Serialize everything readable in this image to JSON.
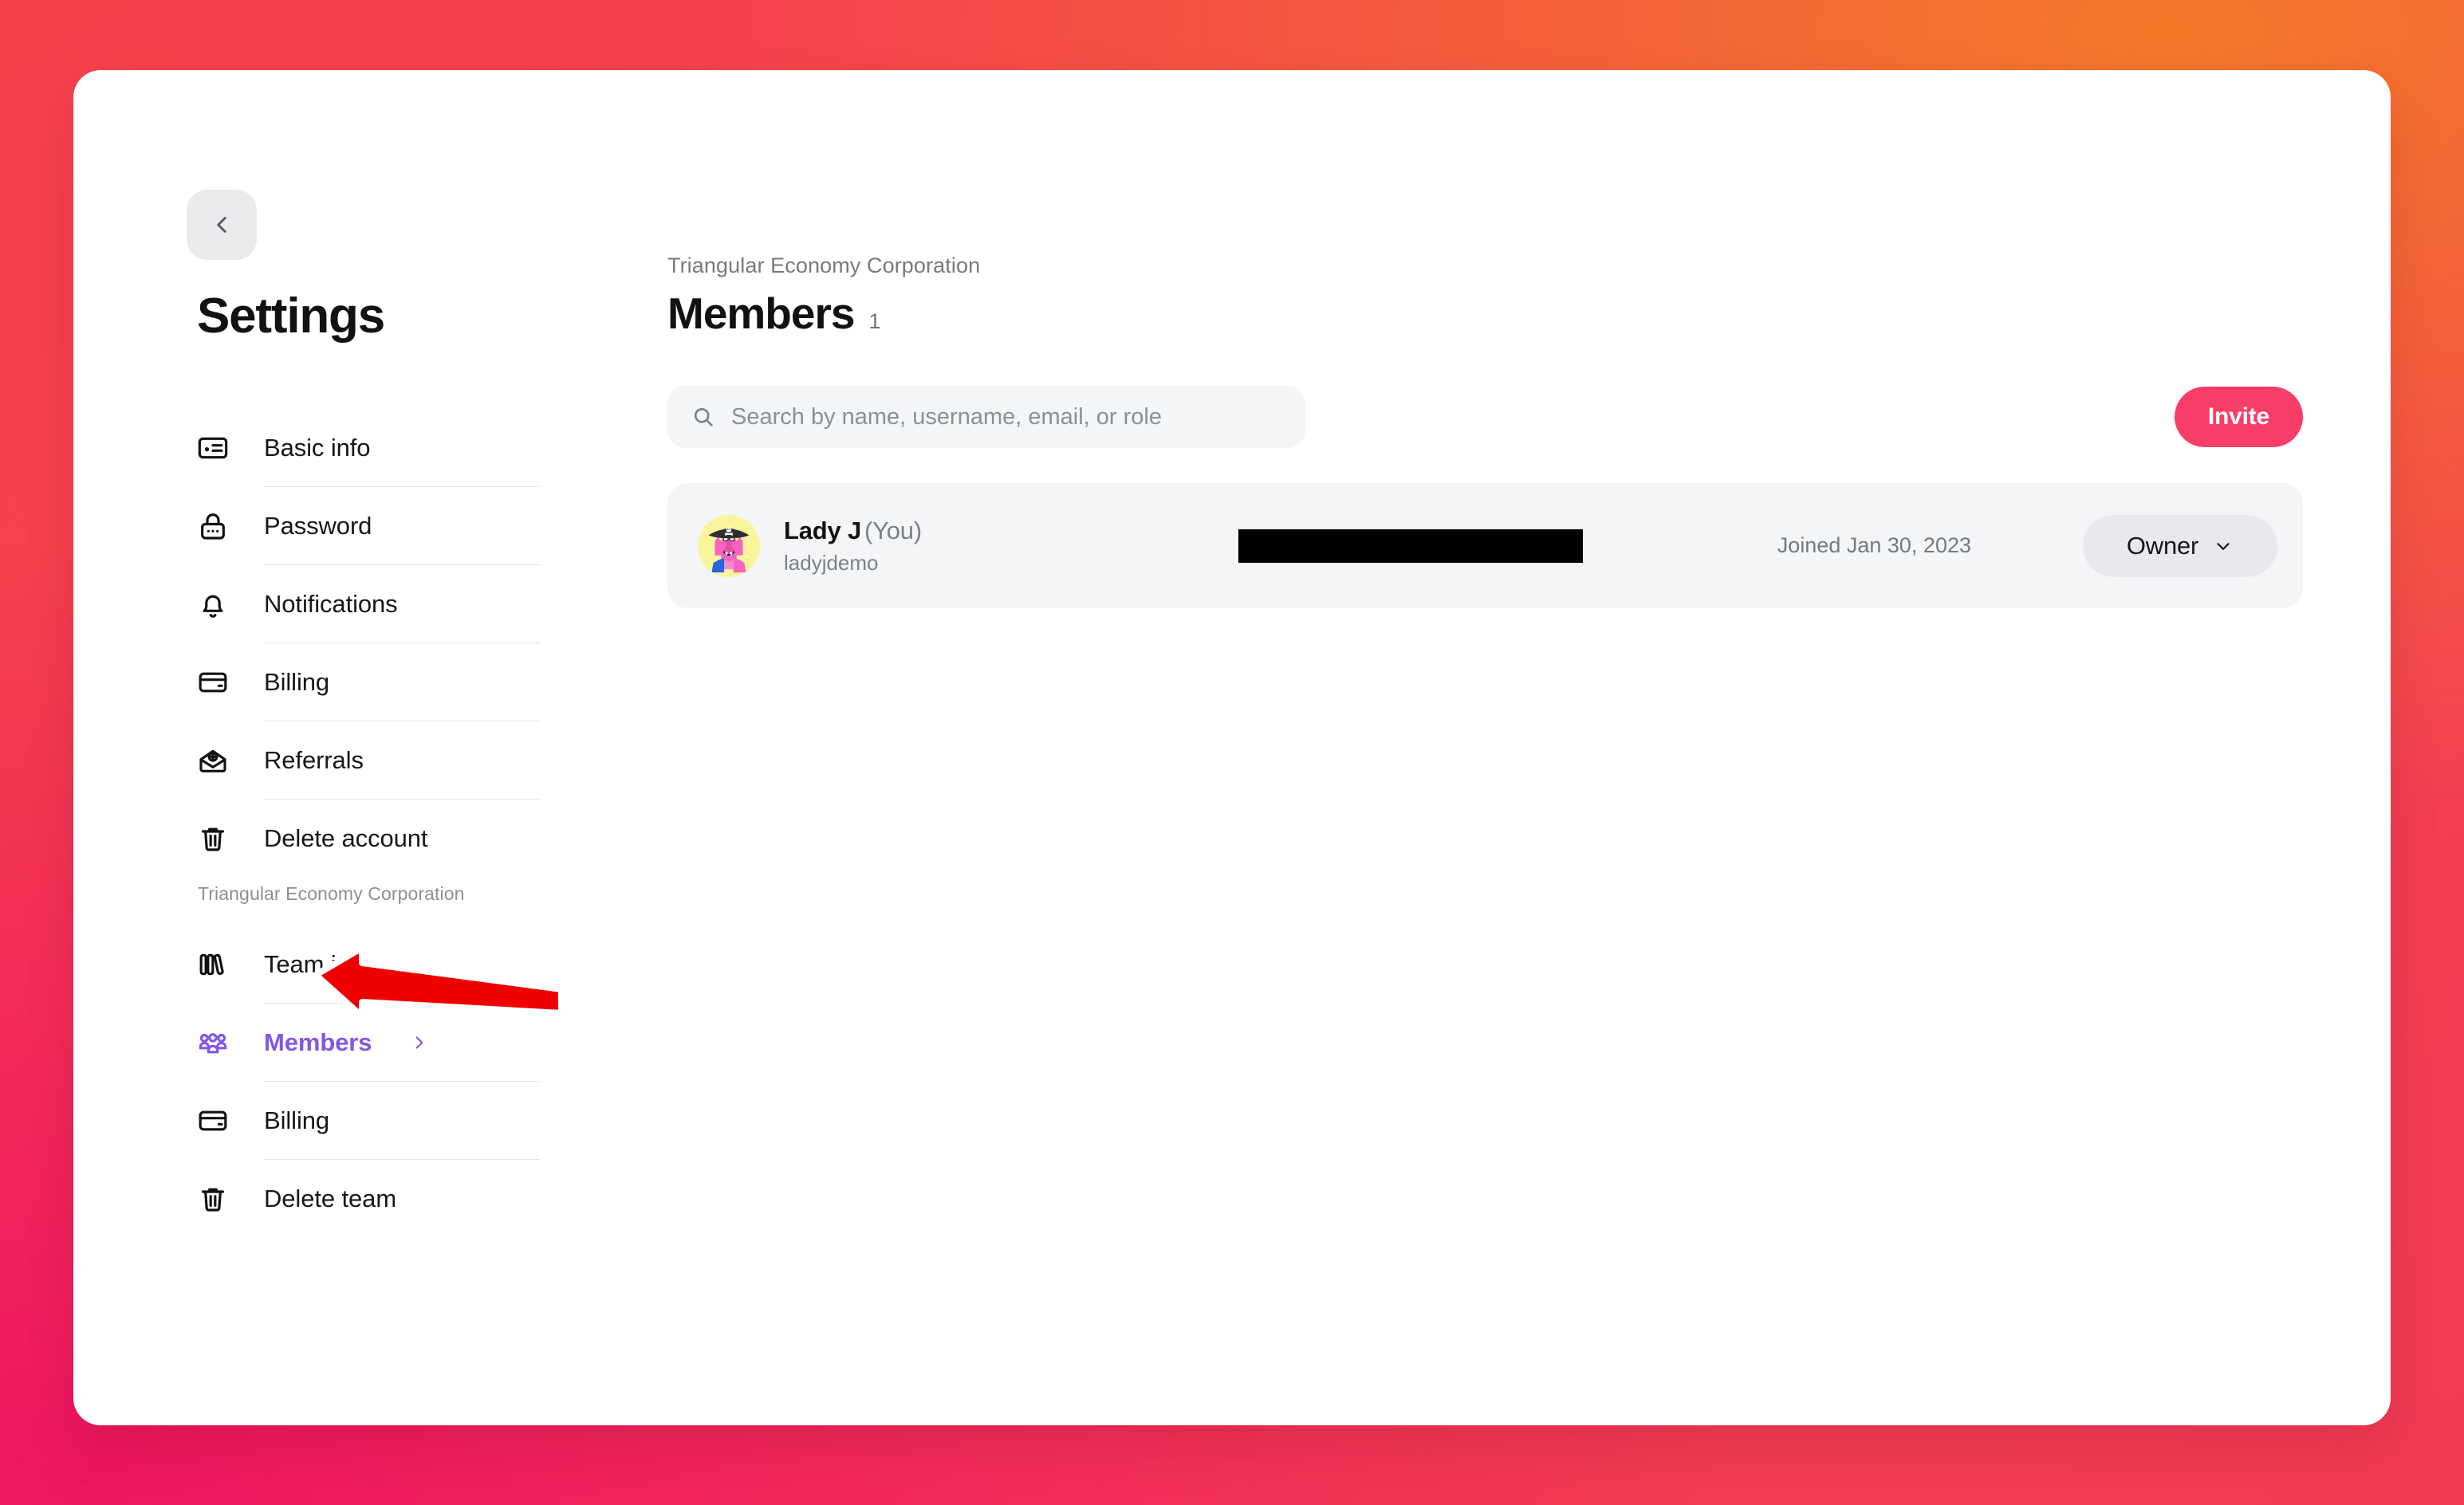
{
  "window": {
    "background_gradient": [
      "#F6414B",
      "#F5782A",
      "#EE1560"
    ],
    "card_background": "#FFFFFF"
  },
  "sidebar": {
    "back_button_icon": "chevron-left-icon",
    "title": "Settings",
    "personal_items": [
      {
        "label": "Basic info",
        "icon": "id-card-icon"
      },
      {
        "label": "Password",
        "icon": "lock-icon"
      },
      {
        "label": "Notifications",
        "icon": "bell-icon"
      },
      {
        "label": "Billing",
        "icon": "credit-card-icon"
      },
      {
        "label": "Referrals",
        "icon": "envelope-plus-icon"
      },
      {
        "label": "Delete account",
        "icon": "trash-icon"
      }
    ],
    "team_label": "Triangular Economy Corporation",
    "team_items": [
      {
        "label": "Team info",
        "icon": "books-icon",
        "active": false
      },
      {
        "label": "Members",
        "icon": "users-icon",
        "active": true
      },
      {
        "label": "Billing",
        "icon": "credit-card-icon",
        "active": false
      },
      {
        "label": "Delete team",
        "icon": "trash-icon",
        "active": false
      }
    ],
    "active_color": "#8257E6"
  },
  "main": {
    "breadcrumb": "Triangular Economy Corporation",
    "page_title": "Members",
    "member_count": "1",
    "search": {
      "placeholder": "Search by name, username, email, or role",
      "value": "",
      "icon": "search-icon"
    },
    "invite_button": {
      "label": "Invite",
      "color": "#F73D68"
    },
    "members": [
      {
        "avatar": "pirate-monster-avatar",
        "name": "Lady J",
        "you_suffix": "(You)",
        "username": "ladyjdemo",
        "email": "",
        "email_redacted": true,
        "joined": "Joined Jan 30, 2023",
        "role": "Owner",
        "role_chevron_icon": "chevron-down-icon"
      }
    ]
  },
  "annotation": {
    "type": "arrow",
    "color": "#EE0000",
    "points_to": "sidebar-item-members"
  }
}
